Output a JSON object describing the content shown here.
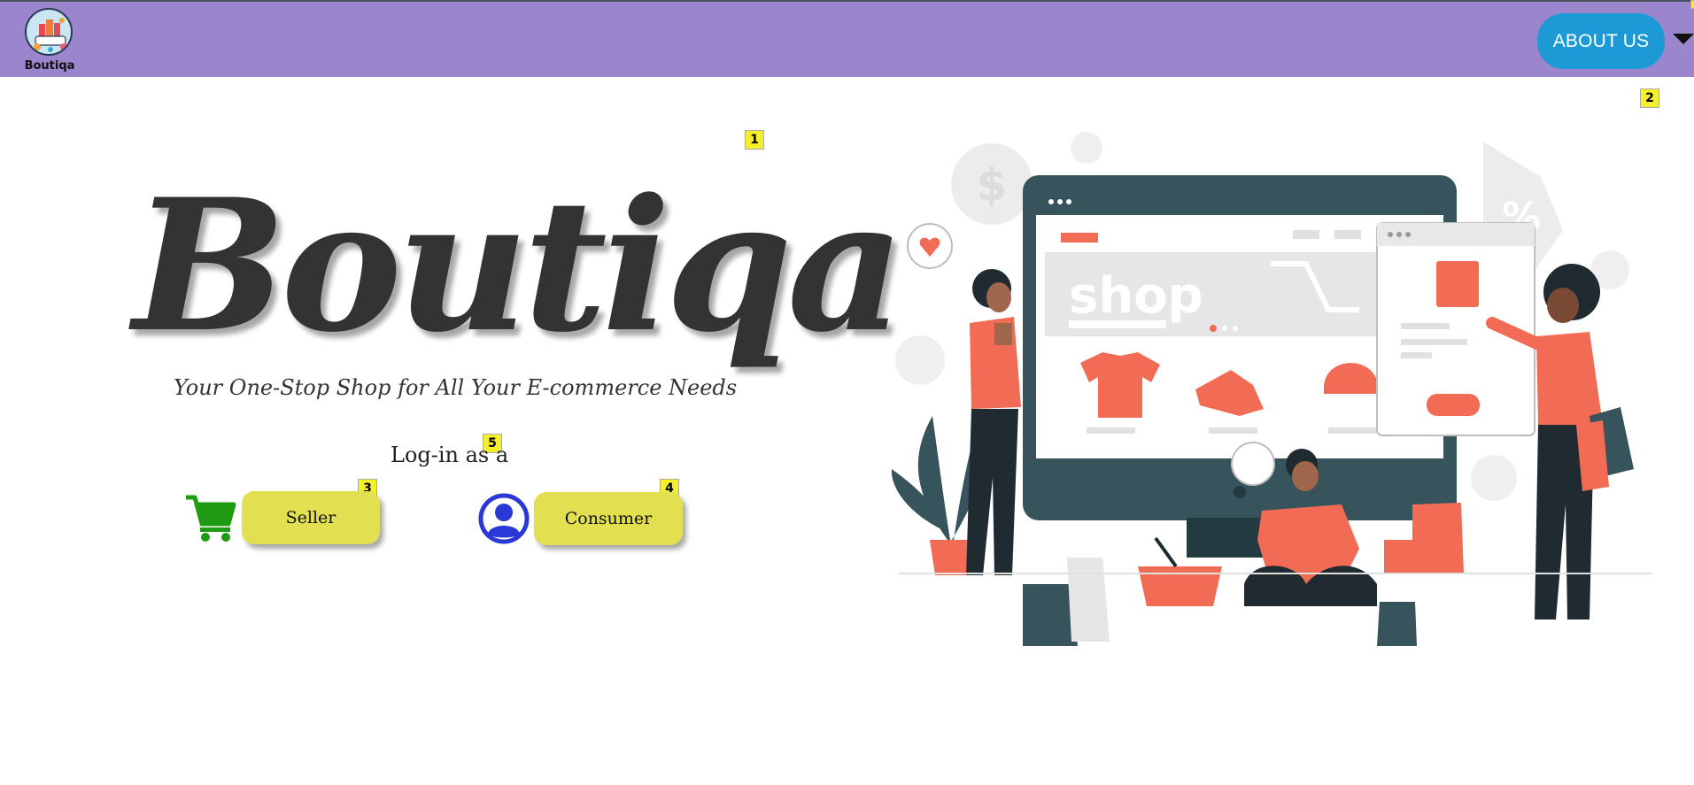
{
  "window": {
    "accent_bar_color": "#4a4f5c"
  },
  "navbar": {
    "background_color": "#9b86cd",
    "logo_label": "Boutiqa",
    "about_button_label": "ABOUT US",
    "about_button_color": "#1d9ad6",
    "menu_caret_icon": "caret-down-icon"
  },
  "hero": {
    "title": "Boutiqa",
    "tagline": "Your One-Stop Shop for All Your E-commerce Needs",
    "login_prompt": "Log-in as a",
    "illustration_sign": "shop",
    "illustration_discount": "%"
  },
  "roles": {
    "seller": {
      "label": "Seller",
      "icon": "shopping-cart-icon",
      "icon_color": "#1f9a13"
    },
    "consumer": {
      "label": "Consumer",
      "icon": "user-profile-icon",
      "icon_color": "#2a38d6"
    },
    "button_color": "#e2e050"
  },
  "markers": [
    "1",
    "2",
    "3",
    "4",
    "5"
  ]
}
